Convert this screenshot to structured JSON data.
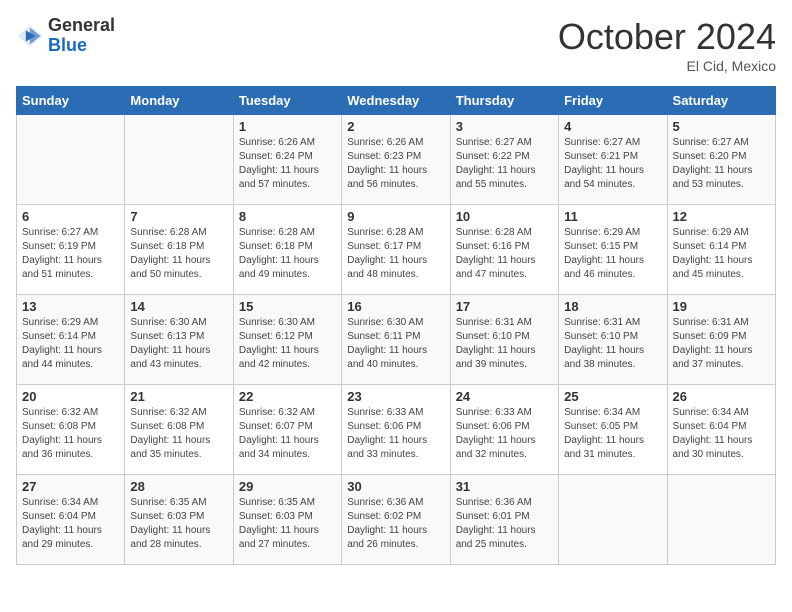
{
  "header": {
    "logo_line1": "General",
    "logo_line2": "Blue",
    "month": "October 2024",
    "location": "El Cid, Mexico"
  },
  "days_of_week": [
    "Sunday",
    "Monday",
    "Tuesday",
    "Wednesday",
    "Thursday",
    "Friday",
    "Saturday"
  ],
  "weeks": [
    [
      {
        "day": "",
        "info": ""
      },
      {
        "day": "",
        "info": ""
      },
      {
        "day": "1",
        "info": "Sunrise: 6:26 AM\nSunset: 6:24 PM\nDaylight: 11 hours and 57 minutes."
      },
      {
        "day": "2",
        "info": "Sunrise: 6:26 AM\nSunset: 6:23 PM\nDaylight: 11 hours and 56 minutes."
      },
      {
        "day": "3",
        "info": "Sunrise: 6:27 AM\nSunset: 6:22 PM\nDaylight: 11 hours and 55 minutes."
      },
      {
        "day": "4",
        "info": "Sunrise: 6:27 AM\nSunset: 6:21 PM\nDaylight: 11 hours and 54 minutes."
      },
      {
        "day": "5",
        "info": "Sunrise: 6:27 AM\nSunset: 6:20 PM\nDaylight: 11 hours and 53 minutes."
      }
    ],
    [
      {
        "day": "6",
        "info": "Sunrise: 6:27 AM\nSunset: 6:19 PM\nDaylight: 11 hours and 51 minutes."
      },
      {
        "day": "7",
        "info": "Sunrise: 6:28 AM\nSunset: 6:18 PM\nDaylight: 11 hours and 50 minutes."
      },
      {
        "day": "8",
        "info": "Sunrise: 6:28 AM\nSunset: 6:18 PM\nDaylight: 11 hours and 49 minutes."
      },
      {
        "day": "9",
        "info": "Sunrise: 6:28 AM\nSunset: 6:17 PM\nDaylight: 11 hours and 48 minutes."
      },
      {
        "day": "10",
        "info": "Sunrise: 6:28 AM\nSunset: 6:16 PM\nDaylight: 11 hours and 47 minutes."
      },
      {
        "day": "11",
        "info": "Sunrise: 6:29 AM\nSunset: 6:15 PM\nDaylight: 11 hours and 46 minutes."
      },
      {
        "day": "12",
        "info": "Sunrise: 6:29 AM\nSunset: 6:14 PM\nDaylight: 11 hours and 45 minutes."
      }
    ],
    [
      {
        "day": "13",
        "info": "Sunrise: 6:29 AM\nSunset: 6:14 PM\nDaylight: 11 hours and 44 minutes."
      },
      {
        "day": "14",
        "info": "Sunrise: 6:30 AM\nSunset: 6:13 PM\nDaylight: 11 hours and 43 minutes."
      },
      {
        "day": "15",
        "info": "Sunrise: 6:30 AM\nSunset: 6:12 PM\nDaylight: 11 hours and 42 minutes."
      },
      {
        "day": "16",
        "info": "Sunrise: 6:30 AM\nSunset: 6:11 PM\nDaylight: 11 hours and 40 minutes."
      },
      {
        "day": "17",
        "info": "Sunrise: 6:31 AM\nSunset: 6:10 PM\nDaylight: 11 hours and 39 minutes."
      },
      {
        "day": "18",
        "info": "Sunrise: 6:31 AM\nSunset: 6:10 PM\nDaylight: 11 hours and 38 minutes."
      },
      {
        "day": "19",
        "info": "Sunrise: 6:31 AM\nSunset: 6:09 PM\nDaylight: 11 hours and 37 minutes."
      }
    ],
    [
      {
        "day": "20",
        "info": "Sunrise: 6:32 AM\nSunset: 6:08 PM\nDaylight: 11 hours and 36 minutes."
      },
      {
        "day": "21",
        "info": "Sunrise: 6:32 AM\nSunset: 6:08 PM\nDaylight: 11 hours and 35 minutes."
      },
      {
        "day": "22",
        "info": "Sunrise: 6:32 AM\nSunset: 6:07 PM\nDaylight: 11 hours and 34 minutes."
      },
      {
        "day": "23",
        "info": "Sunrise: 6:33 AM\nSunset: 6:06 PM\nDaylight: 11 hours and 33 minutes."
      },
      {
        "day": "24",
        "info": "Sunrise: 6:33 AM\nSunset: 6:06 PM\nDaylight: 11 hours and 32 minutes."
      },
      {
        "day": "25",
        "info": "Sunrise: 6:34 AM\nSunset: 6:05 PM\nDaylight: 11 hours and 31 minutes."
      },
      {
        "day": "26",
        "info": "Sunrise: 6:34 AM\nSunset: 6:04 PM\nDaylight: 11 hours and 30 minutes."
      }
    ],
    [
      {
        "day": "27",
        "info": "Sunrise: 6:34 AM\nSunset: 6:04 PM\nDaylight: 11 hours and 29 minutes."
      },
      {
        "day": "28",
        "info": "Sunrise: 6:35 AM\nSunset: 6:03 PM\nDaylight: 11 hours and 28 minutes."
      },
      {
        "day": "29",
        "info": "Sunrise: 6:35 AM\nSunset: 6:03 PM\nDaylight: 11 hours and 27 minutes."
      },
      {
        "day": "30",
        "info": "Sunrise: 6:36 AM\nSunset: 6:02 PM\nDaylight: 11 hours and 26 minutes."
      },
      {
        "day": "31",
        "info": "Sunrise: 6:36 AM\nSunset: 6:01 PM\nDaylight: 11 hours and 25 minutes."
      },
      {
        "day": "",
        "info": ""
      },
      {
        "day": "",
        "info": ""
      }
    ]
  ]
}
